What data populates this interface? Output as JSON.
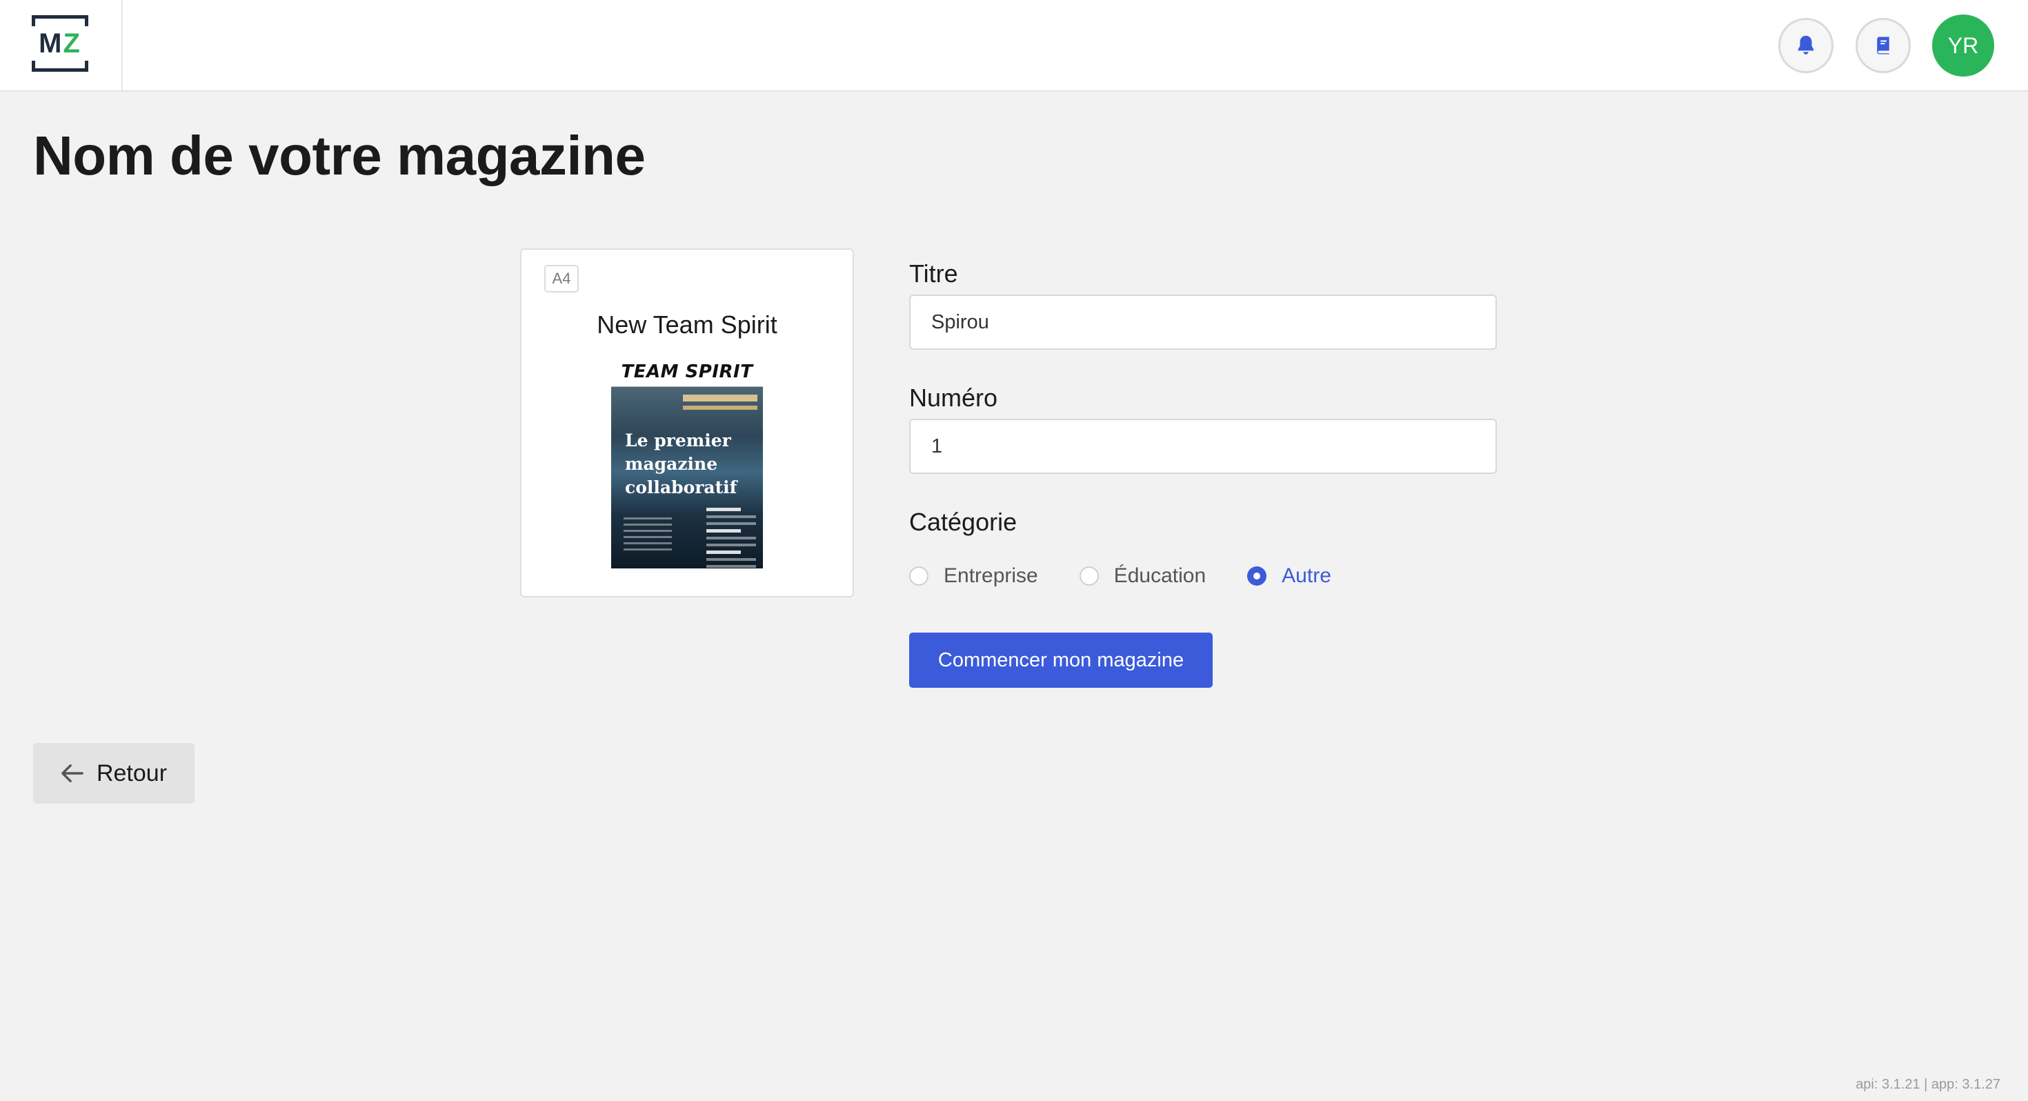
{
  "header": {
    "logo": {
      "m": "M",
      "z": "Z"
    },
    "icons": {
      "notifications": "bell-icon",
      "guide": "book-icon"
    },
    "avatar_initials": "YR",
    "colors": {
      "accent": "#3b5bdb",
      "avatar": "#2ab55a",
      "logo_dark": "#1f2d3d",
      "logo_green": "#2fb35a"
    }
  },
  "page": {
    "title": "Nom de votre magazine"
  },
  "template": {
    "format": "A4",
    "name": "New Team Spirit",
    "cover": {
      "masthead": "TEAM SPIRIT",
      "headline": "Le premier magazine collaboratif"
    }
  },
  "form": {
    "title_label": "Titre",
    "title_value": "Spirou",
    "number_label": "Numéro",
    "number_value": "1",
    "category_label": "Catégorie",
    "categories": [
      {
        "label": "Entreprise",
        "checked": false
      },
      {
        "label": "Éducation",
        "checked": false
      },
      {
        "label": "Autre",
        "checked": true
      }
    ],
    "submit_label": "Commencer mon magazine"
  },
  "back": {
    "label": "Retour"
  },
  "footer": {
    "version": "api: 3.1.21 | app: 3.1.27"
  }
}
